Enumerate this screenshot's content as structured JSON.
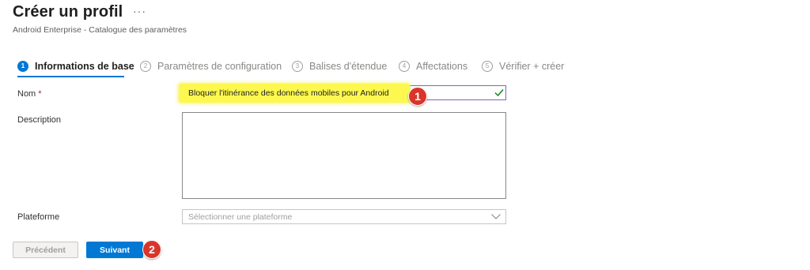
{
  "header": {
    "title": "Créer un profil",
    "more_label": "···",
    "subtitle": "Android Enterprise - Catalogue des paramètres"
  },
  "steps": [
    {
      "number": "1",
      "label": "Informations de base",
      "active": true
    },
    {
      "number": "2",
      "label": "Paramètres de configuration",
      "active": false
    },
    {
      "number": "3",
      "label": "Balises d'étendue",
      "active": false
    },
    {
      "number": "4",
      "label": "Affectations",
      "active": false
    },
    {
      "number": "5",
      "label": "Vérifier + créer",
      "active": false
    }
  ],
  "form": {
    "name_label": "Nom",
    "required_mark": "*",
    "name_value": "Bloquer l'itinérance des données mobiles pour Android",
    "name_valid_icon": "checkmark-icon",
    "description_label": "Description",
    "description_value": "",
    "platform_label": "Plateforme",
    "platform_placeholder": "Sélectionner une plateforme"
  },
  "footer": {
    "previous_label": "Précédent",
    "next_label": "Suivant"
  },
  "annotations": [
    {
      "number": "1",
      "color": "#d9352b"
    },
    {
      "number": "2",
      "color": "#d9352b"
    }
  ],
  "colors": {
    "accent": "#0078d4",
    "highlight": "#fdf84f",
    "valid_check": "#107c10",
    "focus_border": "#8764b8"
  }
}
